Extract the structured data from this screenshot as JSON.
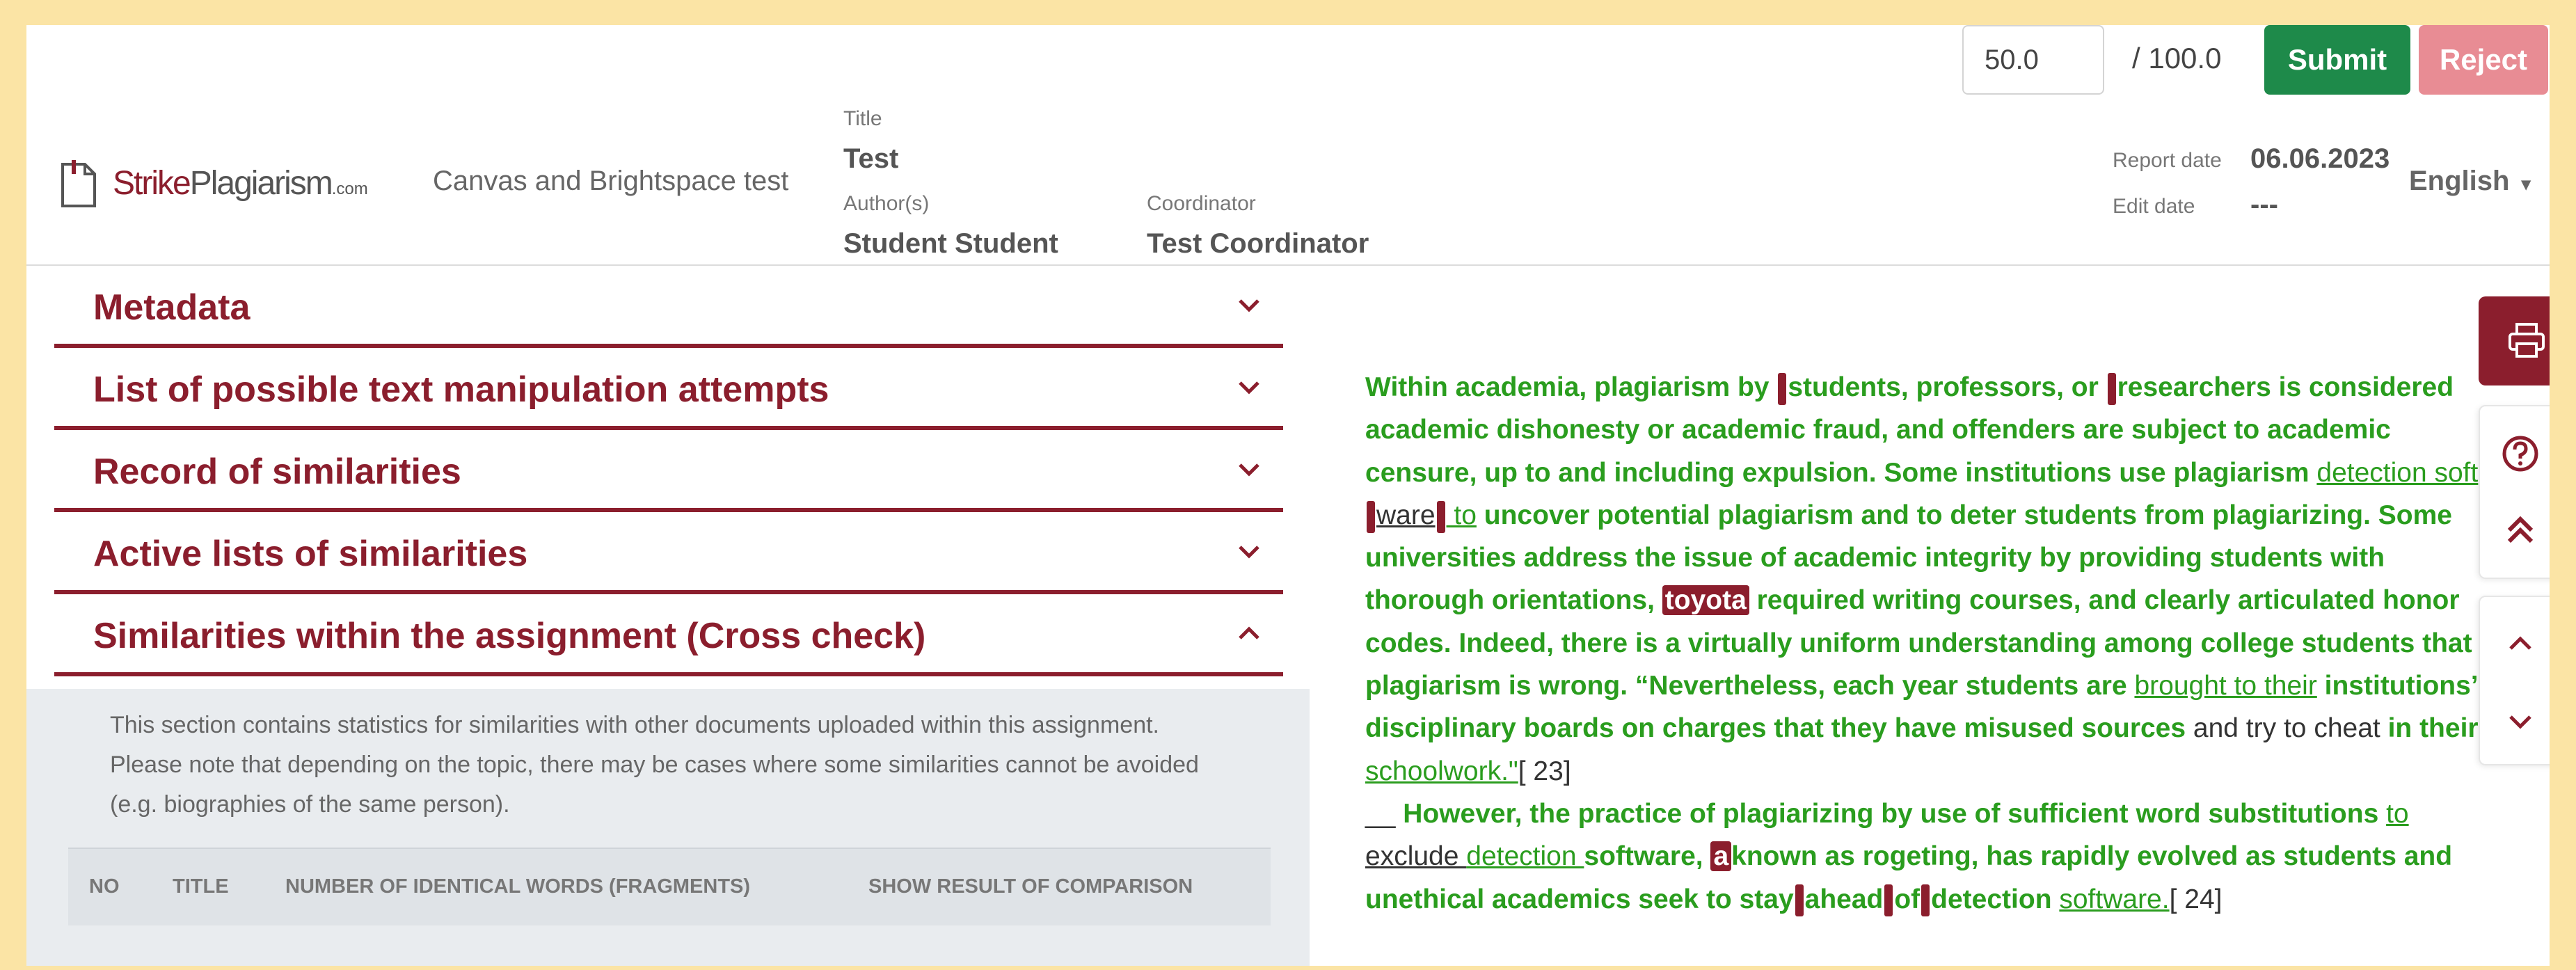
{
  "header": {
    "logo": {
      "strike": "Strike",
      "plagiarism": "Plagiarism",
      "com": ".com"
    },
    "course": "Canvas and Brightspace test",
    "title_label": "Title",
    "title_value": "Test",
    "authors_label": "Author(s)",
    "authors_value": "Student Student",
    "coordinator_label": "Coordinator",
    "coordinator_value": "Test Coordinator",
    "report_date_label": "Report date",
    "report_date_value": "06.06.2023",
    "edit_date_label": "Edit date",
    "edit_date_value": "---",
    "score_value": "50.0",
    "score_max": "/ 100.0",
    "submit_label": "Submit",
    "reject_label": "Reject",
    "language": "English",
    "colors": {
      "brand": "#8b1e2d",
      "submit": "#1e8a4a",
      "reject": "#e88c94",
      "match_text": "#2a9d1e"
    }
  },
  "accordion": [
    {
      "label": "Metadata",
      "expanded": false
    },
    {
      "label": "List of possible text manipulation attempts",
      "expanded": false
    },
    {
      "label": "Record of similarities",
      "expanded": false
    },
    {
      "label": "Active lists of similarities",
      "expanded": false
    },
    {
      "label": "Similarities within the assignment (Cross check)",
      "expanded": true
    }
  ],
  "crosscheck": {
    "note": "This section contains statistics for similarities with other documents uploaded within this assignment. Please note that depending on the topic, there may be cases where some similarities cannot be avoided (e.g. biographies of the same person).",
    "columns": [
      "NO",
      "TITLE",
      "NUMBER OF IDENTICAL WORDS (FRAGMENTS)",
      "SHOW RESULT OF COMPARISON"
    ]
  },
  "document": {
    "p1a": "Within academia, plagiarism by ",
    "p1b": "students, professors, or ",
    "p1c": "researchers is considered academic dishonesty or academic fraud, and offenders are subject to academic censure, up to and including expulsion. Some institutions use plagiarism ",
    "p1d": " detection  soft",
    "p1e": "ware",
    "p1f": " to",
    "p1g": " uncover potential plagiarism and to deter students from plagiarizing. Some universities address the issue of academic integrity by providing students with thorough orientations, ",
    "p1h": "toyota",
    "p1i": " required writing courses, and clearly articulated honor codes. Indeed, there is a virtually uniform understanding among college students that plagiarism is wrong. “Nevertheless, each year students are ",
    "p1j": " brought  to  their",
    "p1k": " institutions’ disciplinary boards on charges that they have misused sources ",
    "p1l": "  and try to cheat ",
    "p1m": " in their ",
    "p1n": " schoolwork.\"",
    "p1o": "[ 23]",
    "p2a": "__ ",
    "p2b": "However, the practice of plagiarizing by use of sufficient word substitutions ",
    "p2c": " to ",
    "p2d": "  exclude ",
    "p2e": " detection ",
    "p2f": "software, ",
    "p2g": "a",
    "p2h": "known as rogeting, has  rapidly evolved as students and  unethical academics seek to stay",
    "p2i": "ahead",
    "p2j": "of",
    "p2k": "detection ",
    "p2l": " software.",
    "p2m": "[ 24]"
  }
}
